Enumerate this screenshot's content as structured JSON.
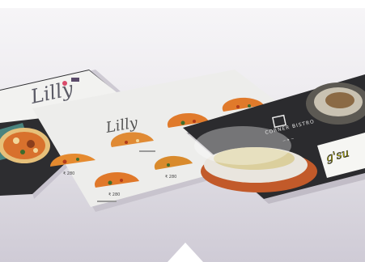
{
  "menu_left": {
    "brand": "Lilly",
    "price": "₹ 280"
  },
  "menu_center": {
    "brand": "Lilly",
    "prices": [
      "₹ 280",
      "₹ 280",
      "₹ 280"
    ]
  },
  "menu_right": {
    "brand": "CORNER BISTRO",
    "brand_sub": "─ ✦ ─",
    "accent_text": "g'su",
    "accent_color": "#f0e800"
  },
  "icons": [
    "rose-icon",
    "pizza-icon",
    "coffee-icon"
  ]
}
